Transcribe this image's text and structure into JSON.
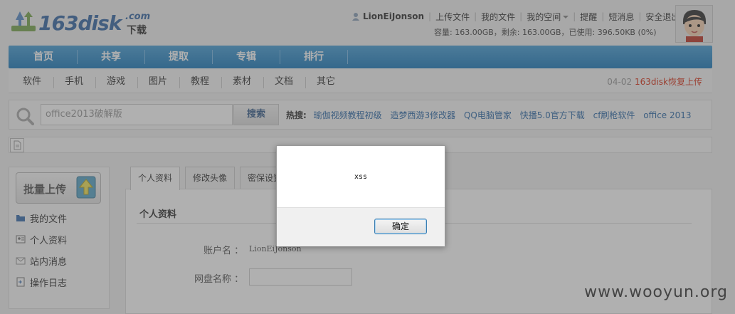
{
  "header": {
    "logo_text": "163disk",
    "logo_com": ".com",
    "logo_sub": "下载",
    "username": "LionEiJonson",
    "nav_links": [
      "上传文件",
      "我的文件",
      "我的空间",
      "提醒",
      "短消息",
      "安全退出"
    ],
    "quota": "容量: 163.00GB，剩余: 163.00GB，已使用: 396.50KB (0%)"
  },
  "main_nav": [
    "首页",
    "共享",
    "提取",
    "专辑",
    "排行"
  ],
  "sub_nav": [
    "软件",
    "手机",
    "游戏",
    "图片",
    "教程",
    "素材",
    "文档",
    "其它"
  ],
  "notice": {
    "date": "04-02",
    "text": "163disk恢复上传"
  },
  "search": {
    "value": "office2013破解版",
    "button": "搜索",
    "hot_label": "热搜:",
    "hot_items": [
      "瑜伽视频教程初级",
      "造梦西游3修改器",
      "QQ电脑管家",
      "快播5.0官方下载",
      "cf刷枪软件",
      "office 2013"
    ]
  },
  "sidebar": {
    "upload_label": "批量上传",
    "items": [
      "我的文件",
      "个人资料",
      "站内消息",
      "操作日志"
    ]
  },
  "tabs": [
    "个人资料",
    "修改头像",
    "密保设置"
  ],
  "profile": {
    "section_title": "个人资料",
    "account_label": "账户名 ：",
    "account_value": "LionEiJonson",
    "disk_name_label": "网盘名称 ："
  },
  "dialog": {
    "message": "xss",
    "ok_label": "确定"
  },
  "watermark": "www.wooyun.org",
  "colors": {
    "nav_blue": "#1f7cbd",
    "link_blue": "#2e6aa8",
    "notice_red": "#d9341b"
  }
}
